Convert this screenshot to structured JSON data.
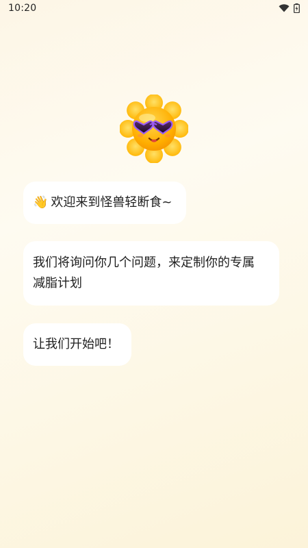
{
  "status_bar": {
    "time": "10:20",
    "icons": [
      "wifi-icon",
      "battery-charging-icon"
    ]
  },
  "mascot": {
    "icon": "sun-with-heart-sunglasses-icon",
    "colors": {
      "petal": "#ffc629",
      "face": "#ffb300",
      "glasses": "#8a5cf6"
    }
  },
  "messages": [
    {
      "emoji": "👋",
      "text": "欢迎来到怪兽轻断食~"
    },
    {
      "line1": "我们将询问你几个问题，来定制你的专属",
      "line2": "减脂计划"
    },
    {
      "text": "让我们开始吧！"
    }
  ]
}
